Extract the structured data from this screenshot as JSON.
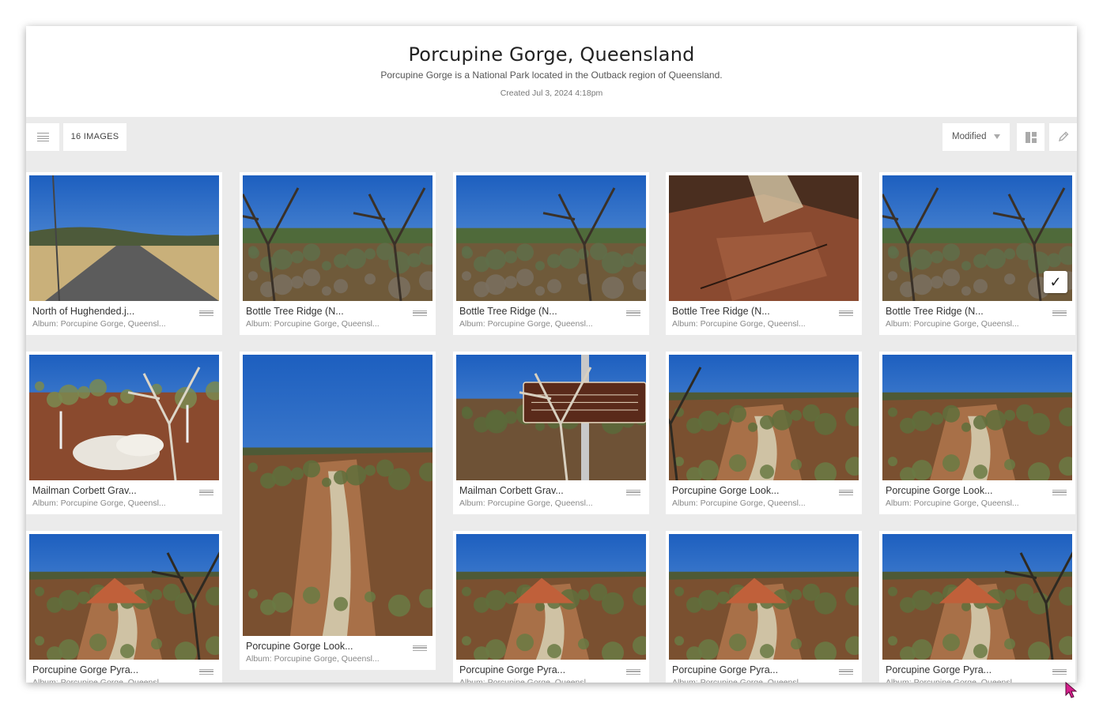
{
  "header": {
    "title": "Porcupine Gorge, Queensland",
    "subtitle": "Porcupine Gorge is a National Park located in the Outback region of Queensland.",
    "created": "Created Jul 3, 2024 4:18pm"
  },
  "toolbar": {
    "menu_icon": "hamburger-icon",
    "count_label": "16 IMAGES",
    "sort_label": "Modified",
    "layout_icon": "grid-layout-icon",
    "edit_icon": "pencil-icon"
  },
  "images": [
    {
      "title": "North of Hughended.j...",
      "album": "Album: Porcupine Gorge, Queensl...",
      "scene": "road"
    },
    {
      "title": "Bottle Tree Ridge (N...",
      "album": "Album: Porcupine Gorge, Queensl...",
      "scene": "scrub"
    },
    {
      "title": "Bottle Tree Ridge (N...",
      "album": "Album: Porcupine Gorge, Queensl...",
      "scene": "scrub2"
    },
    {
      "title": "Bottle Tree Ridge (N...",
      "album": "Album: Porcupine Gorge, Queensl...",
      "scene": "rock"
    },
    {
      "title": "Bottle Tree Ridge (N...",
      "album": "Album: Porcupine Gorge, Queensl...",
      "scene": "scrub3",
      "selected": true
    },
    {
      "title": "Mailman Corbett Grav...",
      "album": "Album: Porcupine Gorge, Queensl...",
      "scene": "grave"
    },
    {
      "title": "Porcupine Gorge Look...",
      "album": "Album: Porcupine Gorge, Queensl...",
      "scene": "gorge-tall"
    },
    {
      "title": "Mailman Corbett Grav...",
      "album": "Album: Porcupine Gorge, Queensl...",
      "scene": "sign"
    },
    {
      "title": "Porcupine Gorge Look...",
      "album": "Album: Porcupine Gorge, Queensl...",
      "scene": "gorge"
    },
    {
      "title": "Porcupine Gorge Look...",
      "album": "Album: Porcupine Gorge, Queensl...",
      "scene": "gorge2"
    },
    {
      "title": "Porcupine Gorge Pyra...",
      "album": "Album: Porcupine Gorge, Queensl...",
      "scene": "pyramid"
    },
    {
      "title": "Porcupine Gorge Pyra...",
      "album": "Album: Porcupine Gorge, Queensl...",
      "scene": "pyramid2"
    },
    {
      "title": "Porcupine Gorge Pyra...",
      "album": "Album: Porcupine Gorge, Queensl...",
      "scene": "pyramid3"
    },
    {
      "title": "Porcupine Gorge Pyra...",
      "album": "Album: Porcupine Gorge, Queensl...",
      "scene": "pyramid4"
    }
  ],
  "selected_check": "✓",
  "colors": {
    "background": "#ebebeb",
    "card": "#ffffff",
    "sky": "#2f6fc4"
  }
}
